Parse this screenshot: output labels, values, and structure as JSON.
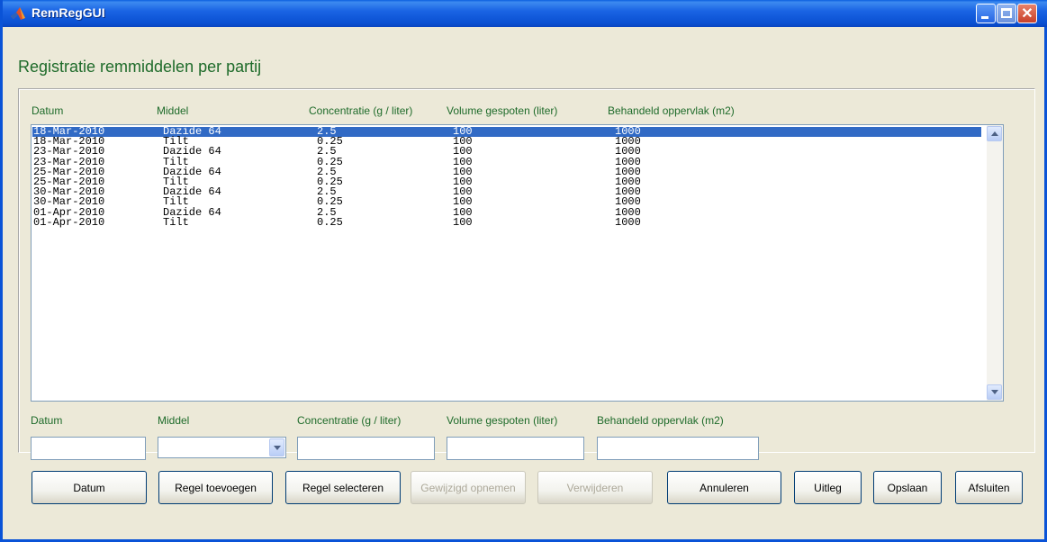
{
  "window": {
    "title": "RemRegGUI"
  },
  "heading": "Registratie remmiddelen per partij",
  "columns": [
    "Datum",
    "Middel",
    "Concentratie (g / liter)",
    "Volume gespoten (liter)",
    "Behandeld oppervlak (m2)"
  ],
  "rows": [
    [
      "18-Mar-2010",
      "Dazide 64",
      "2.5",
      "100",
      "1000"
    ],
    [
      "18-Mar-2010",
      "Tilt",
      "0.25",
      "100",
      "1000"
    ],
    [
      "23-Mar-2010",
      "Dazide 64",
      "2.5",
      "100",
      "1000"
    ],
    [
      "23-Mar-2010",
      "Tilt",
      "0.25",
      "100",
      "1000"
    ],
    [
      "25-Mar-2010",
      "Dazide 64",
      "2.5",
      "100",
      "1000"
    ],
    [
      "25-Mar-2010",
      "Tilt",
      "0.25",
      "100",
      "1000"
    ],
    [
      "30-Mar-2010",
      "Dazide 64",
      "2.5",
      "100",
      "1000"
    ],
    [
      "30-Mar-2010",
      "Tilt",
      "0.25",
      "100",
      "1000"
    ],
    [
      "01-Apr-2010",
      "Dazide 64",
      "2.5",
      "100",
      "1000"
    ],
    [
      "01-Apr-2010",
      "Tilt",
      "0.25",
      "100",
      "1000"
    ]
  ],
  "selected_row": 0,
  "form": {
    "labels": [
      "Datum",
      "Middel",
      "Concentratie (g / liter)",
      "Volume gespoten (liter)",
      "Behandeld oppervlak (m2)"
    ],
    "values": {
      "datum": "",
      "middel": "",
      "concentratie": "",
      "volume": "",
      "oppervlak": ""
    }
  },
  "buttons": {
    "datum": "Datum",
    "regel_toevoegen": "Regel toevoegen",
    "regel_selecteren": "Regel selecteren",
    "gewijzigd_opnemen": "Gewijzigd opnemen",
    "verwijderen": "Verwijderen",
    "annuleren": "Annuleren",
    "uitleg": "Uitleg",
    "opslaan": "Opslaan",
    "afsluiten": "Afsluiten"
  },
  "colors": {
    "label_green": "#1e6b2a",
    "selection": "#316ac5",
    "titlebar": "#0a50d2"
  }
}
